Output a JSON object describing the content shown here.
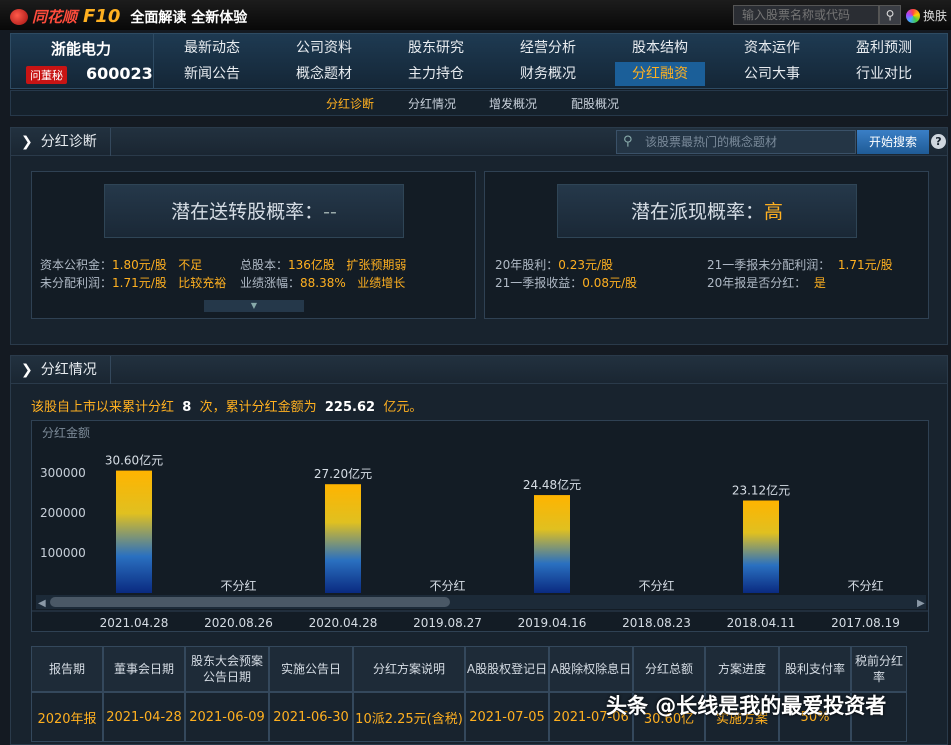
{
  "brand": {
    "name": "同花顺",
    "f10": "F10",
    "slogan": "全面解读 全新体验"
  },
  "top_search": {
    "placeholder": "输入股票名称或代码",
    "skin_label": "换肤"
  },
  "stock": {
    "name": "浙能电力",
    "badge": "问董秘",
    "code": "600023"
  },
  "nav": {
    "row1": [
      "最新动态",
      "公司资料",
      "股东研究",
      "经营分析",
      "股本结构",
      "资本运作",
      "盈利预测"
    ],
    "row2": [
      "新闻公告",
      "概念题材",
      "主力持仓",
      "财务概况",
      "分红融资",
      "公司大事",
      "行业对比"
    ],
    "active": "分红融资"
  },
  "subnav": {
    "items": [
      "分红诊断",
      "分红情况",
      "增发概况",
      "配股概况"
    ],
    "active": "分红诊断"
  },
  "diagnosis": {
    "title": "分红诊断",
    "search_placeholder": "该股票最热门的概念题材",
    "search_button": "开始搜索",
    "help": "?",
    "left": {
      "label": "潜在送转股概率：",
      "value": "--",
      "rows": [
        {
          "k1": "资本公积金：",
          "v1": "1.80元/股",
          "n1": "不足",
          "k2": "总股本：",
          "v2": "136亿股",
          "n2": "扩张预期弱"
        },
        {
          "k1": "未分配利润：",
          "v1": "1.71元/股",
          "n1": "比较充裕",
          "k2": "业绩涨幅：",
          "v2": "88.38%",
          "n2": "业绩增长"
        }
      ]
    },
    "right": {
      "label": "潜在派现概率：",
      "value": "高",
      "rows": [
        {
          "k1": "20年股利：",
          "v1": "0.23元/股",
          "k2": "21一季报未分配利润：",
          "v2": "1.71元/股"
        },
        {
          "k1": "21一季报收益：",
          "v1": "0.08元/股",
          "k2": "20年报是否分红：",
          "v2": "是"
        }
      ]
    }
  },
  "dividend": {
    "title": "分红情况",
    "summary_prefix": "该股自上市以来累计分红",
    "count": "8",
    "summary_mid": "次，累计分红金额为",
    "amount": "225.62",
    "summary_suffix": "亿元。"
  },
  "chart_data": {
    "type": "bar",
    "ylabel": "分红金额",
    "ylim": [
      0,
      400000
    ],
    "yticks": [
      100000,
      200000,
      300000
    ],
    "categories": [
      "2021.04.28",
      "2020.08.26",
      "2020.04.28",
      "2019.08.27",
      "2019.04.16",
      "2018.08.23",
      "2018.04.11",
      "2017.08.19"
    ],
    "values": [
      306000,
      0,
      272000,
      0,
      244800,
      0,
      231200,
      0
    ],
    "labels": [
      "30.60亿元",
      "不分红",
      "27.20亿元",
      "不分红",
      "24.48亿元",
      "不分红",
      "23.12亿元",
      "不分红"
    ]
  },
  "table": {
    "headers": [
      "报告期",
      "董事会日期",
      "股东大会预案公告日期",
      "实施公告日",
      "分红方案说明",
      "A股股权登记日",
      "A股除权除息日",
      "分红总额",
      "方案进度",
      "股利支付率",
      "税前分红率"
    ],
    "rows": [
      [
        "2020年报",
        "2021-04-28",
        "2021-06-09",
        "2021-06-30",
        "10派2.25元(含税)",
        "2021-07-05",
        "2021-07-06",
        "30.60亿",
        "实施方案",
        "50%",
        ""
      ]
    ]
  },
  "watermark": "头条 @长线是我的最爱投资者"
}
